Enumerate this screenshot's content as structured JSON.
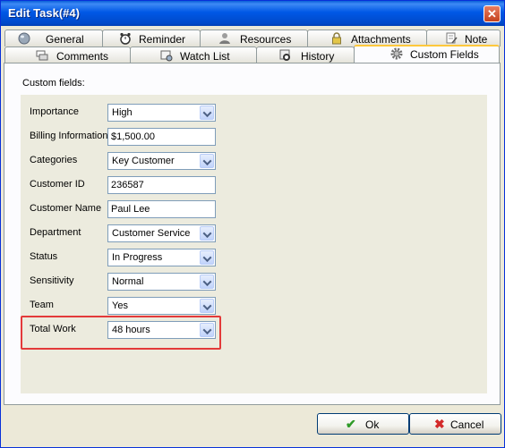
{
  "window": {
    "title": "Edit Task(#4)",
    "close_glyph": "✕"
  },
  "tabs_row1": [
    {
      "label": "General",
      "icon": "globe-icon"
    },
    {
      "label": "Reminder",
      "icon": "alarm-clock-icon"
    },
    {
      "label": "Resources",
      "icon": "user-icon"
    },
    {
      "label": "Attachments",
      "icon": "lock-icon"
    },
    {
      "label": "Note",
      "icon": "note-icon"
    }
  ],
  "tabs_row2": [
    {
      "label": "Comments",
      "icon": "comments-icon"
    },
    {
      "label": "Watch List",
      "icon": "watch-list-icon"
    },
    {
      "label": "History",
      "icon": "history-icon"
    },
    {
      "label": "Custom Fields",
      "icon": "gear-icon",
      "active": true
    }
  ],
  "group_label": "Custom fields:",
  "fields": [
    {
      "label": "Importance",
      "type": "combo",
      "value": "High"
    },
    {
      "label": "Billing Information",
      "type": "text",
      "value": "$1,500.00"
    },
    {
      "label": "Categories",
      "type": "combo",
      "value": "Key Customer"
    },
    {
      "label": "Customer ID",
      "type": "text",
      "value": "236587"
    },
    {
      "label": "Customer Name",
      "type": "text",
      "value": "Paul Lee"
    },
    {
      "label": "Department",
      "type": "combo",
      "value": "Customer Service"
    },
    {
      "label": "Status",
      "type": "combo",
      "value": "In Progress"
    },
    {
      "label": "Sensitivity",
      "type": "combo",
      "value": "Normal"
    },
    {
      "label": "Team",
      "type": "combo",
      "value": "Yes"
    },
    {
      "label": "Total Work",
      "type": "combo",
      "value": "48 hours"
    }
  ],
  "buttons": {
    "ok": {
      "label": "Ok",
      "glyph": "✔",
      "color": "#2e9a27"
    },
    "cancel": {
      "label": "Cancel",
      "glyph": "✖",
      "color": "#d32a2a"
    }
  },
  "colors": {
    "title_bar": "#0058e6",
    "highlight": "#e33a3a",
    "active_tab_accent": "#ffc83c"
  }
}
